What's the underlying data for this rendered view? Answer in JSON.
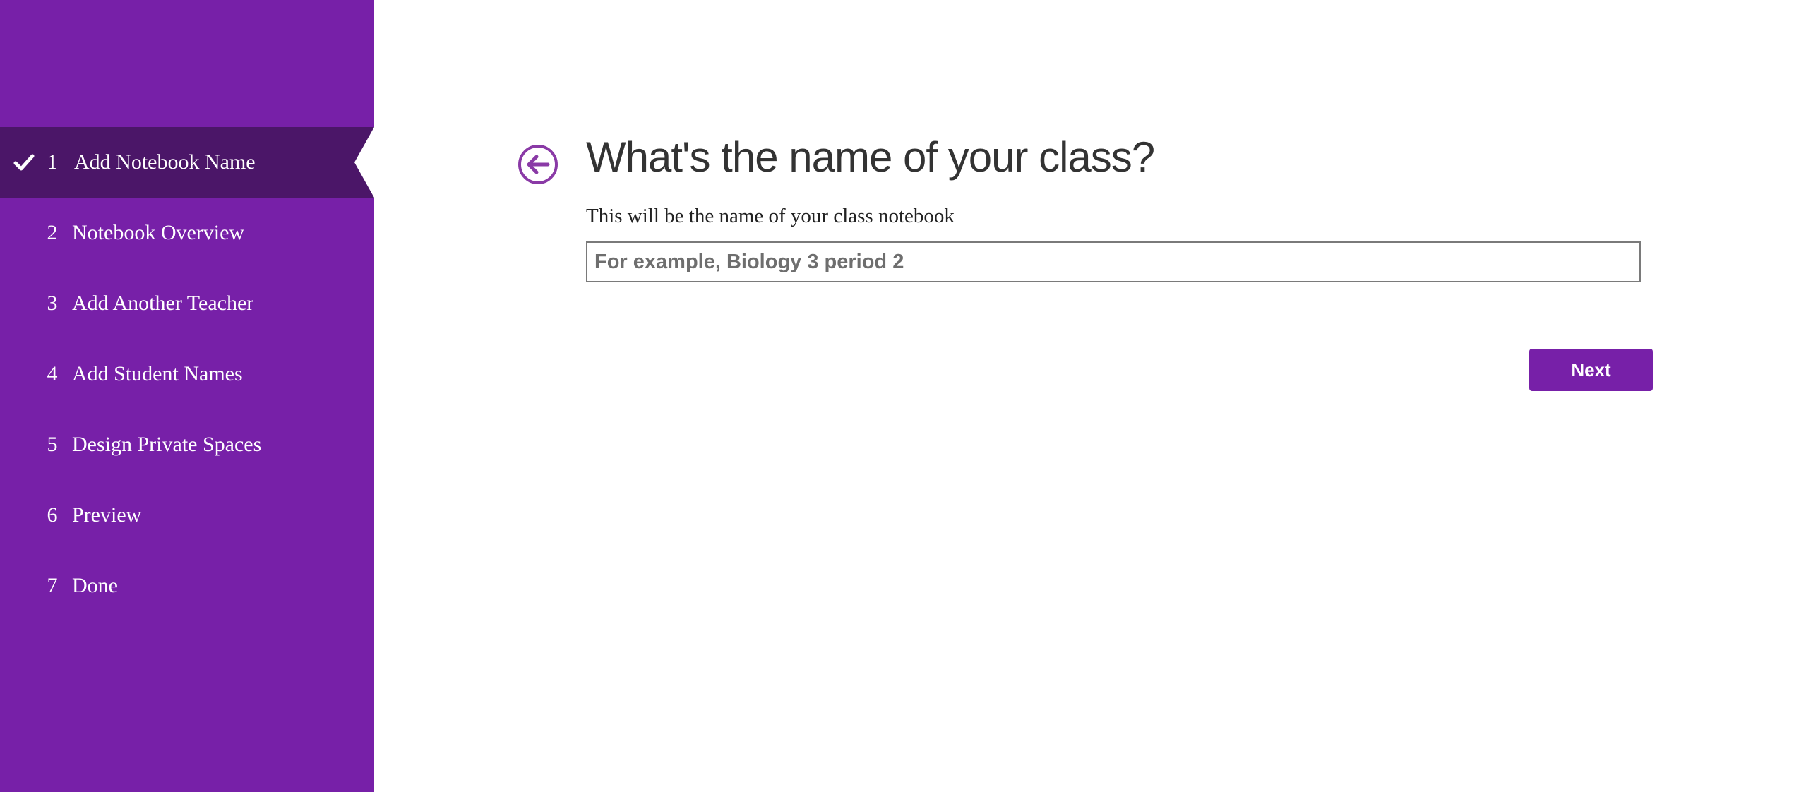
{
  "sidebar": {
    "steps": [
      {
        "number": "1",
        "label": "Add Notebook Name",
        "state": "active",
        "completed": true
      },
      {
        "number": "2",
        "label": "Notebook Overview",
        "state": "pending"
      },
      {
        "number": "3",
        "label": "Add Another Teacher",
        "state": "pending"
      },
      {
        "number": "4",
        "label": "Add Student Names",
        "state": "pending"
      },
      {
        "number": "5",
        "label": "Design Private Spaces",
        "state": "pending"
      },
      {
        "number": "6",
        "label": "Preview",
        "state": "pending"
      },
      {
        "number": "7",
        "label": "Done",
        "state": "pending"
      }
    ],
    "check_icon": "checkmark-icon"
  },
  "main": {
    "back_icon": "circle-arrow-left-icon",
    "title": "What's the name of your class?",
    "subtitle": "This will be the name of your class notebook",
    "name_input": {
      "value": "",
      "placeholder": "For example, Biology 3 period 2"
    },
    "next_label": "Next"
  },
  "colors": {
    "sidebar_bg": "#7720a8",
    "active_step_bg": "#4b1668",
    "accent": "#7720a8",
    "back_icon": "#8a3aa6"
  }
}
